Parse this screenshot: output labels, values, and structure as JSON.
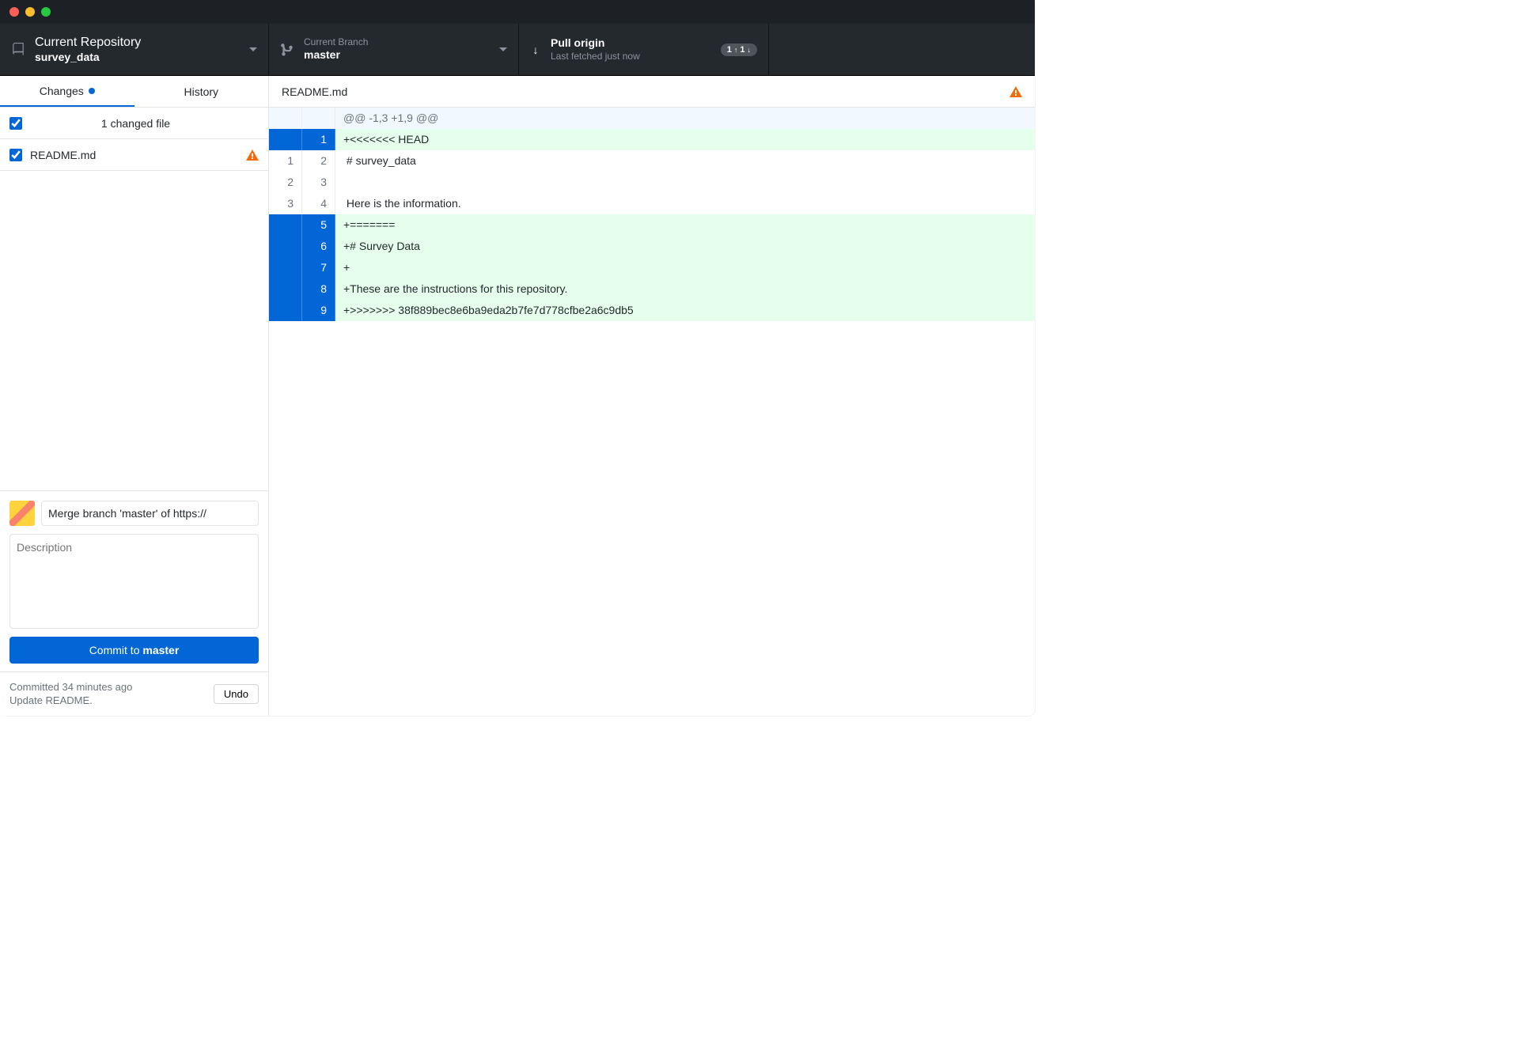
{
  "toolbar": {
    "repo_label": "Current Repository",
    "repo_name": "survey_data",
    "branch_label": "Current Branch",
    "branch_name": "master",
    "pull_label": "Pull origin",
    "pull_sub": "Last fetched just now",
    "pull_badge_up": "1",
    "pull_badge_down": "1"
  },
  "sidebar": {
    "tab_changes": "Changes",
    "tab_history": "History",
    "files_header": "1 changed file",
    "file_name": "README.md"
  },
  "commit": {
    "summary": "Merge branch 'master' of https://",
    "desc_placeholder": "Description",
    "button_prefix": "Commit to ",
    "button_branch": "master",
    "status_line1": "Committed 34 minutes ago",
    "status_line2": "Update README.",
    "undo": "Undo"
  },
  "diff": {
    "file": "README.md",
    "hunk": "@@ -1,3 +1,9 @@",
    "lines": [
      {
        "old": "",
        "new": "1",
        "kind": "conf add",
        "text": "+<<<<<<< HEAD"
      },
      {
        "old": "1",
        "new": "2",
        "kind": "ctx",
        "text": " # survey_data"
      },
      {
        "old": "2",
        "new": "3",
        "kind": "ctx",
        "text": " "
      },
      {
        "old": "3",
        "new": "4",
        "kind": "ctx",
        "text": " Here is the information."
      },
      {
        "old": "",
        "new": "5",
        "kind": "conf add",
        "text": "+======="
      },
      {
        "old": "",
        "new": "6",
        "kind": "conf add",
        "text": "+# Survey Data"
      },
      {
        "old": "",
        "new": "7",
        "kind": "conf add",
        "text": "+"
      },
      {
        "old": "",
        "new": "8",
        "kind": "conf add",
        "text": "+These are the instructions for this repository."
      },
      {
        "old": "",
        "new": "9",
        "kind": "conf add",
        "text": "+>>>>>>> 38f889bec8e6ba9eda2b7fe7d778cfbe2a6c9db5"
      }
    ]
  }
}
